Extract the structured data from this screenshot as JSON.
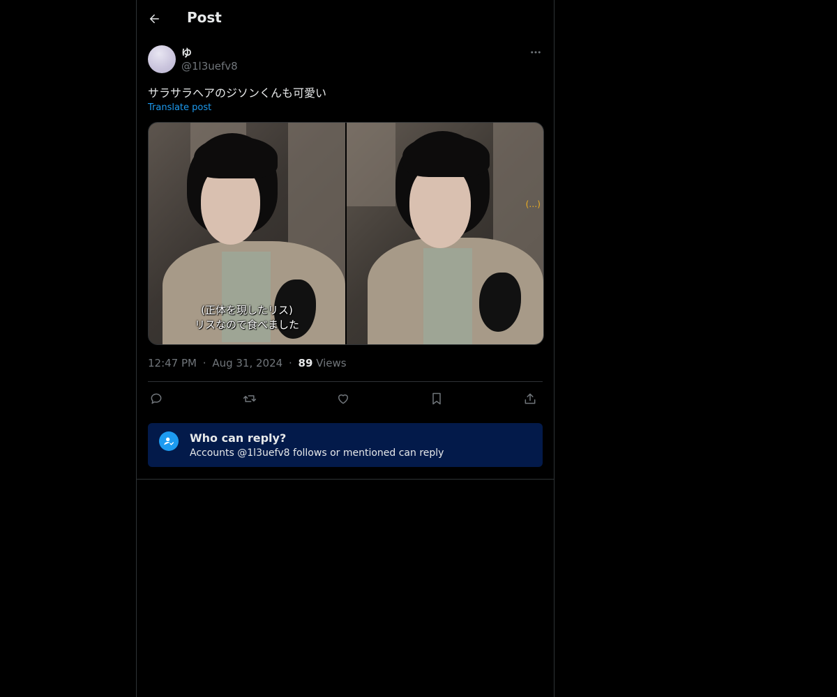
{
  "header": {
    "title": "Post"
  },
  "post": {
    "author": {
      "display_name": "ゆ",
      "handle": "@1l3uefv8"
    },
    "text": "サラサラヘアのジソンくんも可愛い",
    "translate_label": "Translate post",
    "media": {
      "caption_line1": "(正体を現したリス)",
      "caption_line2": "リスなので食べました",
      "overlay_text": "(…)"
    },
    "time": "12:47 PM",
    "date": "Aug 31, 2024",
    "dot": "·",
    "views_count": "89",
    "views_label": "Views"
  },
  "reply_restriction": {
    "title": "Who can reply?",
    "subtitle": "Accounts @1l3uefv8 follows or mentioned can reply"
  },
  "colors": {
    "background": "#000000",
    "accent": "#1d9bf0",
    "muted": "#71767b",
    "banner": "#031a4a"
  }
}
